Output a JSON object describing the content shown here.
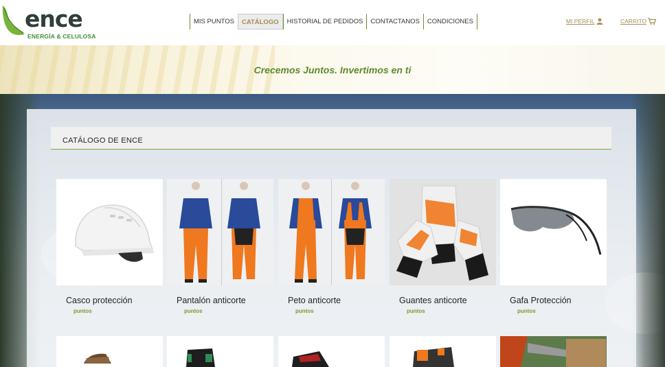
{
  "brand": {
    "name": "ence",
    "tagline": "ENERGÍA & CELULOSA",
    "logo_color": "#7ab33e"
  },
  "nav": {
    "items": [
      {
        "label": "MIS PUNTOS"
      },
      {
        "label": "CATÁLOGO",
        "active": true
      },
      {
        "label": "HISTORIAL DE PEDIDOS"
      },
      {
        "label": "CONTACTANOS"
      },
      {
        "label": "CONDICIONES"
      }
    ]
  },
  "account": {
    "profile_label": "MI PERFIL",
    "profile_icon": "user-icon",
    "cart_label": "CARRITO",
    "cart_icon": "cart-icon"
  },
  "banner": {
    "slogan": "Crecemos Juntos. Invertimos en ti"
  },
  "catalog": {
    "title": "CATÁLOGO DE ENCE",
    "products": [
      {
        "name": "Casco protección",
        "points": "puntos"
      },
      {
        "name": "Pantalón anticorte",
        "points": "puntos"
      },
      {
        "name": "Peto anticorte",
        "points": "puntos"
      },
      {
        "name": "Guantes anticorte",
        "points": "puntos"
      },
      {
        "name": "Gafa Protección",
        "points": "puntos"
      }
    ]
  },
  "colors": {
    "accent_green": "#7ea43c",
    "nav_active": "#a58c4e",
    "slogan": "#5e8a2c"
  }
}
